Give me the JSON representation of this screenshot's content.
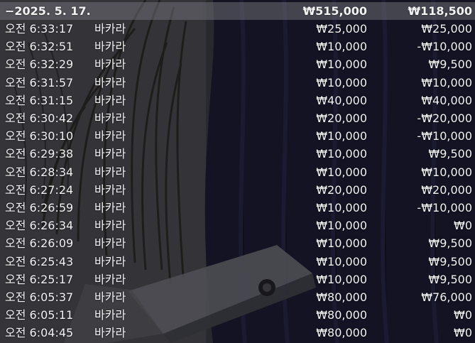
{
  "summary": {
    "date": "−2025. 5. 17.",
    "total_bet": "₩515,000",
    "total_win": "₩118,500"
  },
  "rows": [
    {
      "time": "오전 6:33:17",
      "game": "바카라",
      "bet": "₩25,000",
      "win": "₩25,000"
    },
    {
      "time": "오전 6:32:51",
      "game": "바카라",
      "bet": "₩10,000",
      "win": "-₩10,000"
    },
    {
      "time": "오전 6:32:29",
      "game": "바카라",
      "bet": "₩10,000",
      "win": "₩9,500"
    },
    {
      "time": "오전 6:31:57",
      "game": "바카라",
      "bet": "₩10,000",
      "win": "₩10,000"
    },
    {
      "time": "오전 6:31:15",
      "game": "바카라",
      "bet": "₩40,000",
      "win": "₩40,000"
    },
    {
      "time": "오전 6:30:42",
      "game": "바카라",
      "bet": "₩20,000",
      "win": "-₩20,000"
    },
    {
      "time": "오전 6:30:10",
      "game": "바카라",
      "bet": "₩10,000",
      "win": "-₩10,000"
    },
    {
      "time": "오전 6:29:38",
      "game": "바카라",
      "bet": "₩10,000",
      "win": "₩9,500"
    },
    {
      "time": "오전 6:28:34",
      "game": "바카라",
      "bet": "₩10,000",
      "win": "₩10,000"
    },
    {
      "time": "오전 6:27:24",
      "game": "바카라",
      "bet": "₩20,000",
      "win": "₩20,000"
    },
    {
      "time": "오전 6:26:59",
      "game": "바카라",
      "bet": "₩10,000",
      "win": "-₩10,000"
    },
    {
      "time": "오전 6:26:34",
      "game": "바카라",
      "bet": "₩10,000",
      "win": "₩0"
    },
    {
      "time": "오전 6:26:09",
      "game": "바카라",
      "bet": "₩10,000",
      "win": "₩9,500"
    },
    {
      "time": "오전 6:25:43",
      "game": "바카라",
      "bet": "₩10,000",
      "win": "₩9,500"
    },
    {
      "time": "오전 6:25:17",
      "game": "바카라",
      "bet": "₩10,000",
      "win": "₩9,500"
    },
    {
      "time": "오전 6:05:37",
      "game": "바카라",
      "bet": "₩80,000",
      "win": "₩76,000"
    },
    {
      "time": "오전 6:05:11",
      "game": "바카라",
      "bet": "₩80,000",
      "win": "₩0"
    },
    {
      "time": "오전 6:04:45",
      "game": "바카라",
      "bet": "₩80,000",
      "win": "₩0"
    }
  ]
}
